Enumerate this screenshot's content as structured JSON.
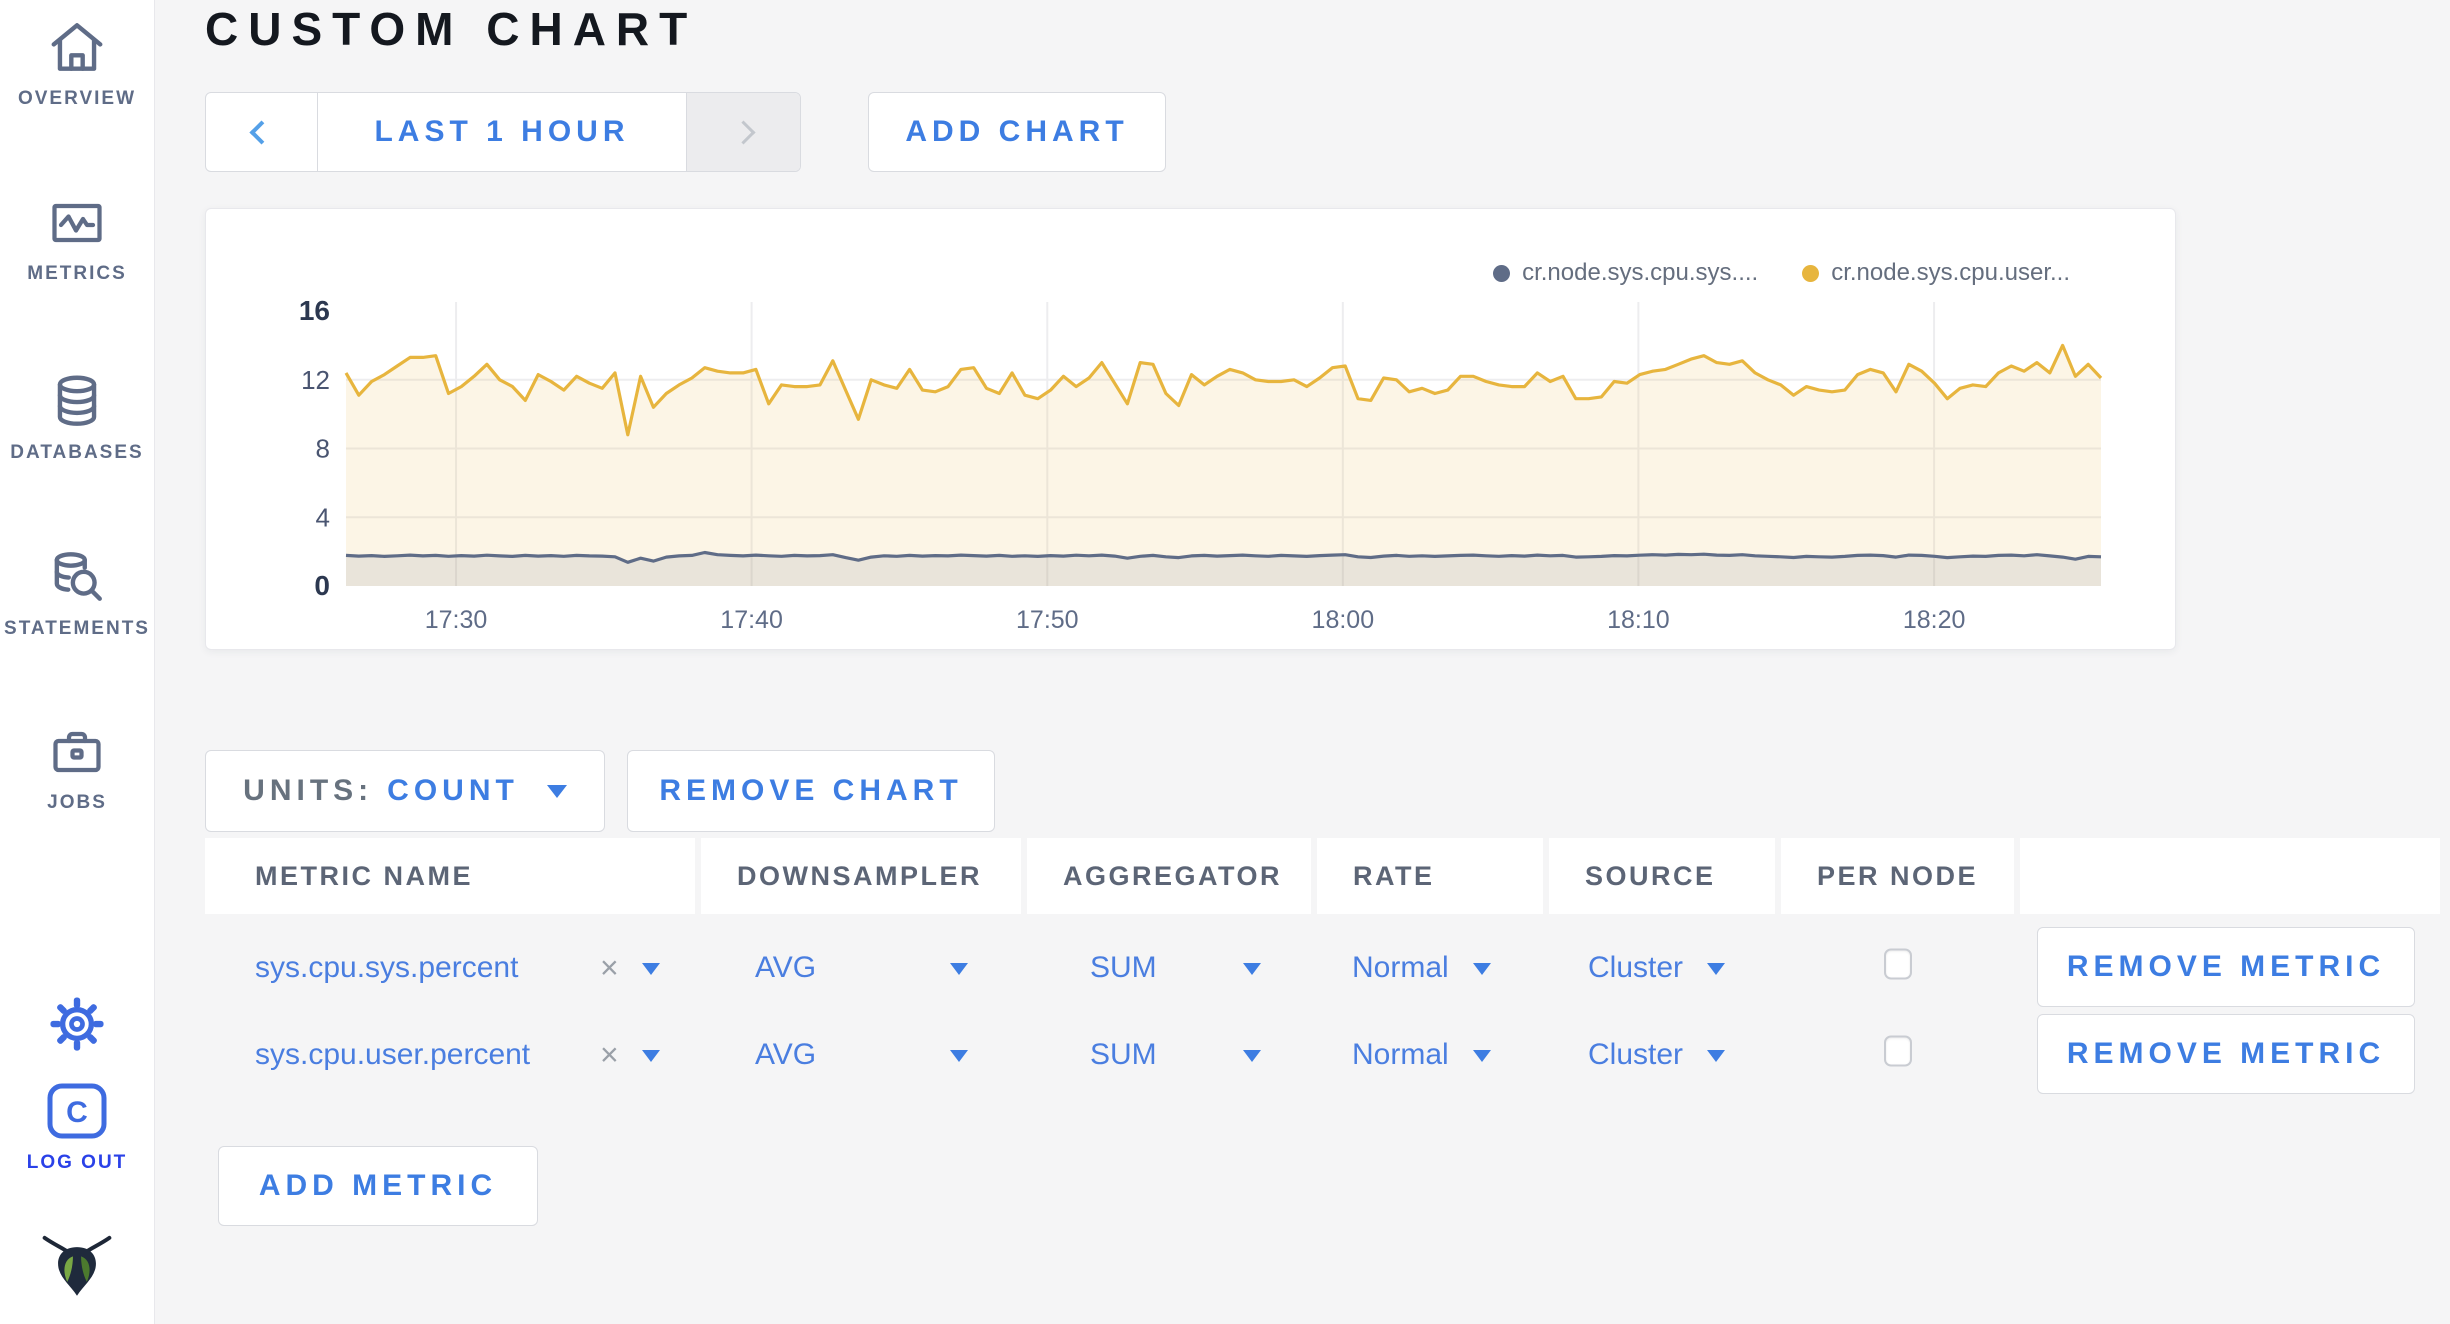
{
  "header": {
    "title": "CUSTOM CHART"
  },
  "toolbar": {
    "time_range": "LAST 1 HOUR",
    "add_chart": "ADD CHART"
  },
  "units": {
    "label": "UNITS:",
    "value": "COUNT"
  },
  "remove_chart_label": "REMOVE CHART",
  "add_metric_label": "ADD METRIC",
  "sidebar": {
    "items": [
      {
        "label": "OVERVIEW",
        "icon": "home-icon"
      },
      {
        "label": "METRICS",
        "icon": "metrics-chart-icon"
      },
      {
        "label": "DATABASES",
        "icon": "database-icon"
      },
      {
        "label": "STATEMENTS",
        "icon": "database-search-icon"
      },
      {
        "label": "JOBS",
        "icon": "briefcase-icon"
      }
    ],
    "settings_icon": "gear-icon",
    "logout_label": "LOG OUT",
    "logo": "cockroach-logo"
  },
  "table": {
    "headers": [
      {
        "label": "METRIC NAME"
      },
      {
        "label": "DOWNSAMPLER"
      },
      {
        "label": "AGGREGATOR"
      },
      {
        "label": "RATE"
      },
      {
        "label": "SOURCE"
      },
      {
        "label": "PER NODE"
      },
      {
        "label": ""
      }
    ],
    "remove_metric_label": "REMOVE METRIC",
    "rows": [
      {
        "metric": "sys.cpu.sys.percent",
        "clear": "×",
        "downsampler": "AVG",
        "aggregator": "SUM",
        "rate": "Normal",
        "source": "Cluster",
        "per_node": false
      },
      {
        "metric": "sys.cpu.user.percent",
        "clear": "×",
        "downsampler": "AVG",
        "aggregator": "SUM",
        "rate": "Normal",
        "source": "Cluster",
        "per_node": false
      }
    ]
  },
  "colors": {
    "accent_blue": "#3d7de2",
    "slate": "#5f6c87",
    "series_yellow": "#e7b53e",
    "page_bg": "#f5f5f6",
    "panel_bg": "#ffffff",
    "border": "#d9dbe0",
    "gridline": "#ececee"
  },
  "chart_data": {
    "type": "area",
    "title": "",
    "xlabel": "",
    "ylabel": "",
    "x_range": [
      "17:26",
      "18:25"
    ],
    "x_ticks": [
      "17:30",
      "17:40",
      "17:50",
      "18:00",
      "18:10",
      "18:20"
    ],
    "x_tick_fractions": [
      0.0627,
      0.2311,
      0.3996,
      0.568,
      0.7364,
      0.9049
    ],
    "ylim": [
      0,
      16
    ],
    "y_ticks": [
      0,
      4,
      8,
      12,
      16
    ],
    "grid": true,
    "legend_position": "top-right",
    "legend": [
      {
        "label": "cr.node.sys.cpu.sys....",
        "color": "#5f6c87"
      },
      {
        "label": "cr.node.sys.cpu.user...",
        "color": "#e7b53e"
      }
    ],
    "series": [
      {
        "name": "cr.node.sys.cpu.user...",
        "color": "#e7b53e",
        "fill": "rgba(231,181,62,0.13)",
        "values": [
          12.4,
          11.1,
          11.9,
          12.3,
          12.8,
          13.3,
          13.3,
          13.4,
          11.2,
          11.6,
          12.2,
          12.9,
          12.0,
          11.6,
          10.8,
          12.3,
          11.9,
          11.4,
          12.2,
          11.8,
          11.5,
          12.4,
          8.8,
          12.2,
          10.4,
          11.2,
          11.7,
          12.1,
          12.7,
          12.5,
          12.4,
          12.4,
          12.6,
          10.6,
          11.7,
          11.6,
          11.6,
          11.7,
          13.1,
          11.4,
          9.7,
          12.0,
          11.7,
          11.5,
          12.6,
          11.4,
          11.3,
          11.6,
          12.6,
          12.7,
          11.5,
          11.2,
          12.4,
          11.1,
          10.9,
          11.4,
          12.2,
          11.6,
          12.1,
          13.0,
          11.8,
          10.6,
          13.0,
          12.9,
          11.2,
          10.5,
          12.3,
          11.7,
          12.2,
          12.6,
          12.4,
          12.0,
          11.9,
          11.9,
          12.0,
          11.6,
          12.1,
          12.7,
          12.8,
          10.9,
          10.8,
          12.1,
          12.0,
          11.3,
          11.5,
          11.2,
          11.4,
          12.2,
          12.2,
          11.9,
          11.7,
          11.6,
          11.6,
          12.4,
          11.9,
          12.2,
          10.9,
          10.9,
          11.0,
          11.9,
          11.8,
          12.3,
          12.5,
          12.6,
          12.9,
          13.2,
          13.4,
          13.0,
          12.9,
          13.1,
          12.4,
          12.0,
          11.7,
          11.1,
          11.6,
          11.4,
          11.3,
          11.4,
          12.3,
          12.6,
          12.4,
          11.3,
          12.9,
          12.5,
          11.8,
          10.9,
          11.5,
          11.7,
          11.6,
          12.4,
          12.8,
          12.5,
          13.0,
          12.4,
          14.0,
          12.2,
          12.9,
          12.1
        ]
      },
      {
        "name": "cr.node.sys.cpu.sys....",
        "color": "#5f6c87",
        "fill": "rgba(95,108,135,0.12)",
        "values": [
          1.78,
          1.74,
          1.77,
          1.72,
          1.76,
          1.8,
          1.75,
          1.78,
          1.73,
          1.77,
          1.74,
          1.79,
          1.75,
          1.72,
          1.78,
          1.74,
          1.77,
          1.73,
          1.78,
          1.75,
          1.74,
          1.7,
          1.38,
          1.62,
          1.45,
          1.68,
          1.75,
          1.78,
          1.95,
          1.82,
          1.78,
          1.75,
          1.8,
          1.76,
          1.73,
          1.78,
          1.75,
          1.77,
          1.82,
          1.65,
          1.5,
          1.68,
          1.76,
          1.73,
          1.78,
          1.74,
          1.77,
          1.75,
          1.8,
          1.77,
          1.74,
          1.78,
          1.73,
          1.76,
          1.72,
          1.77,
          1.74,
          1.79,
          1.76,
          1.8,
          1.74,
          1.62,
          1.73,
          1.78,
          1.7,
          1.65,
          1.75,
          1.78,
          1.74,
          1.77,
          1.8,
          1.76,
          1.73,
          1.78,
          1.75,
          1.72,
          1.77,
          1.8,
          1.82,
          1.7,
          1.66,
          1.74,
          1.78,
          1.73,
          1.76,
          1.72,
          1.75,
          1.78,
          1.8,
          1.76,
          1.73,
          1.77,
          1.74,
          1.8,
          1.76,
          1.78,
          1.68,
          1.7,
          1.72,
          1.77,
          1.75,
          1.79,
          1.82,
          1.8,
          1.84,
          1.82,
          1.85,
          1.8,
          1.78,
          1.82,
          1.76,
          1.73,
          1.7,
          1.66,
          1.72,
          1.7,
          1.68,
          1.72,
          1.78,
          1.8,
          1.77,
          1.68,
          1.8,
          1.78,
          1.73,
          1.65,
          1.7,
          1.74,
          1.72,
          1.78,
          1.8,
          1.76,
          1.82,
          1.75,
          1.68,
          1.56,
          1.72,
          1.7
        ]
      }
    ]
  }
}
